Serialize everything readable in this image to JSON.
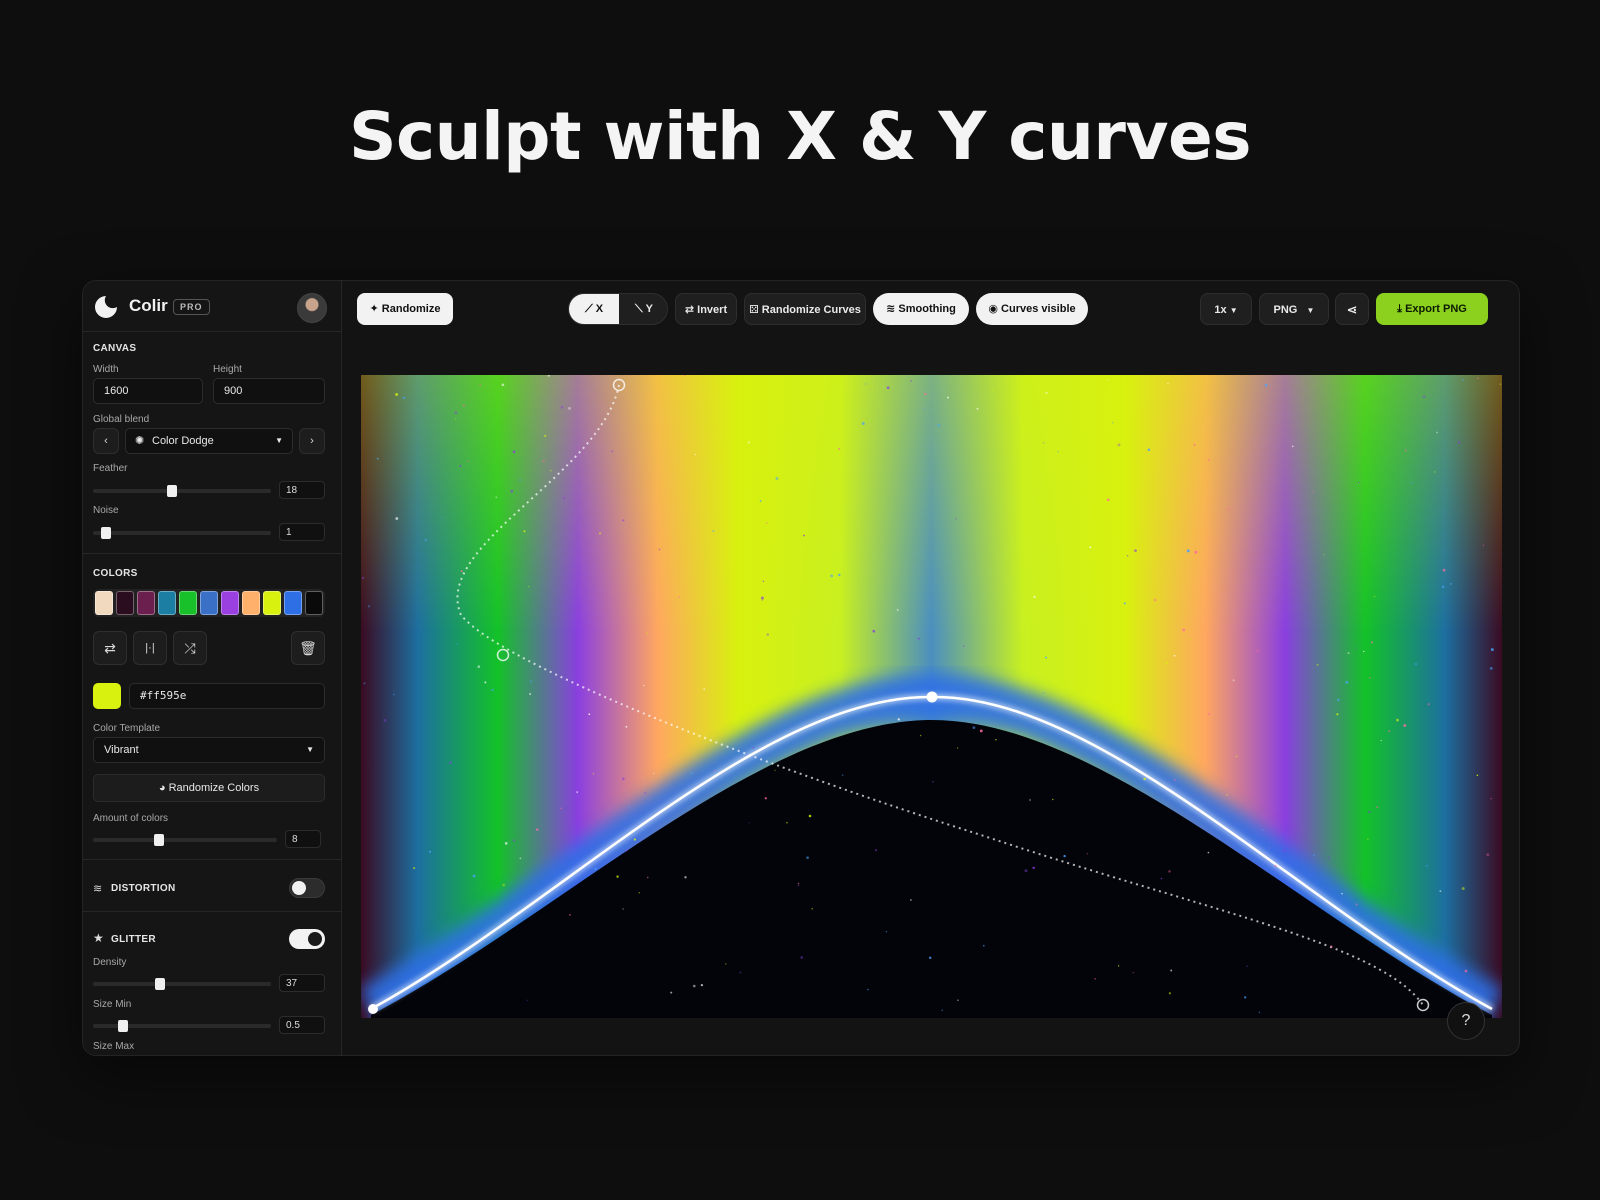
{
  "headline": "Sculpt with X & Y curves",
  "app": {
    "name": "Colir",
    "badge": "PRO"
  },
  "canvas_section": {
    "title": "CANVAS",
    "width_label": "Width",
    "width_value": "1600",
    "height_label": "Height",
    "height_value": "900",
    "blend_label": "Global blend",
    "blend_value": "Color Dodge",
    "feather_label": "Feather",
    "feather_value": "18",
    "feather_level": 0.44,
    "noise_label": "Noise",
    "noise_value": "1",
    "noise_level": 0.05
  },
  "colors_section": {
    "title": "COLORS",
    "swatches": [
      "#f1d9c0",
      "#2a0d1e",
      "#6a1f4e",
      "#1d7ea4",
      "#18c02a",
      "#3a70c6",
      "#9a3fe0",
      "#ffb06a",
      "#d8f10e",
      "#2f6fe6",
      "#0a0a0a"
    ],
    "hex_value": "#ff595e",
    "current_color": "#d8f10e",
    "template_label": "Color Template",
    "template_value": "Vibrant",
    "randomize_label": "Randomize Colors",
    "amount_label": "Amount of colors",
    "amount_value": "8",
    "amount_level": 0.35
  },
  "distortion": {
    "title": "DISTORTION",
    "enabled": false
  },
  "glitter": {
    "title": "GLITTER",
    "enabled": true,
    "density_label": "Density",
    "density_value": "37",
    "density_level": 0.37,
    "size_min_label": "Size Min",
    "size_min_value": "0.5",
    "size_min_level": 0.15,
    "size_max_label": "Size Max"
  },
  "toolbar": {
    "randomize": "Randomize",
    "x_label": "X",
    "y_label": "Y",
    "invert": "Invert",
    "randomize_curves": "Randomize Curves",
    "smoothing": "Smoothing",
    "curves_visible": "Curves visible",
    "scale": "1x",
    "format": "PNG",
    "export": "Export PNG"
  },
  "help": "?",
  "accent": "#8bd11e"
}
